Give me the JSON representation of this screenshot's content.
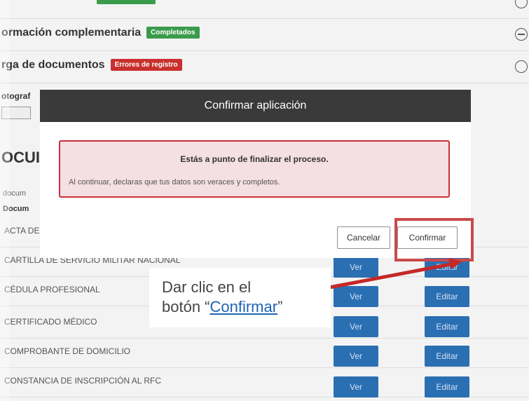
{
  "sections": [
    {
      "title": "ormación complementaria",
      "badge": "Completados",
      "badge_color": "#3a9b4a"
    },
    {
      "title": "rga de documentos",
      "badge": "Errores de registro",
      "badge_color": "#c9302c"
    }
  ],
  "photo_label": "otograf",
  "docs_heading": "OCUI",
  "docs_sub": "docum",
  "docs_col": "Docum",
  "documents": [
    {
      "name": "ACTA DE",
      "ver": "",
      "edit": ""
    },
    {
      "name": "CARTILLA DE SERVICIO MILITAR NACIONAL",
      "ver": "Ver",
      "edit": "Editar"
    },
    {
      "name": "CÉDULA PROFESIONAL",
      "ver": "Ver",
      "edit": "Editar"
    },
    {
      "name": "CERTIFICADO MÉDICO",
      "ver": "Ver",
      "edit": "Editar"
    },
    {
      "name": "COMPROBANTE DE DOMICILIO",
      "ver": "Ver",
      "edit": "Editar"
    },
    {
      "name": "CONSTANCIA DE INSCRIPCIÓN AL RFC",
      "ver": "Ver",
      "edit": "Editar"
    }
  ],
  "modal": {
    "title": "Confirmar aplicación",
    "alert_title": "Estás a punto de finalizar el proceso.",
    "alert_text": "Al continuar, declaras que tus datos son veraces y completos.",
    "cancel_label": "Cancelar",
    "confirm_label": "Confirmar"
  },
  "callout": {
    "line1": "Dar clic en el",
    "line2_prefix": "botón “",
    "link": "Confirmar",
    "line2_suffix": "”"
  },
  "colors": {
    "accent_blue": "#2b6fb3",
    "highlight_red": "#c94a4a",
    "alert_border": "#c9303a"
  }
}
